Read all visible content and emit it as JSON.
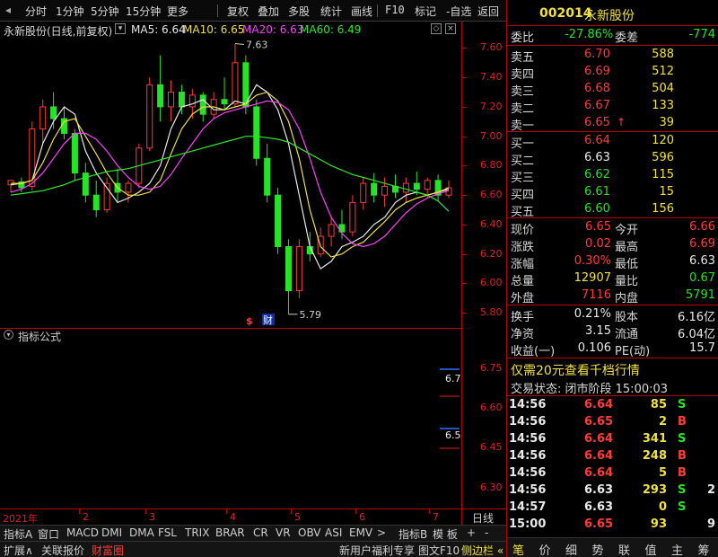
{
  "toolbar": {
    "items": [
      "分时",
      "1分钟",
      "5分钟",
      "15分钟",
      "更多",
      "复权",
      "叠加",
      "多股",
      "统计",
      "画线",
      "F10",
      "标记",
      "-自选",
      "返回"
    ]
  },
  "chart_header": {
    "title": "永新股份(日线,前复权)",
    "ma5_label": "MA5: 6.64",
    "ma10_label": "MA10: 6.65",
    "ma20_label": "MA20: 6.63",
    "ma60_label": "MA60: 6.49"
  },
  "indicator": {
    "title": "指标公式",
    "marker_high": "6.7",
    "marker_low": "6.5"
  },
  "colors": {
    "up": "#ff3b3b",
    "down": "#27e327",
    "ma5": "#e8e8e8",
    "ma10": "#f0e040",
    "ma20": "#ff40ff",
    "ma60": "#2ee82e",
    "axis": "#b40000"
  },
  "chart_data": {
    "type": "candlestick",
    "title": "永新股份(日线,前复权)",
    "y_ticks": [
      "7.60",
      "7.40",
      "7.20",
      "7.00",
      "6.80",
      "6.60",
      "6.40",
      "6.20",
      "6.00",
      "5.80"
    ],
    "ylim": [
      5.74,
      7.67
    ],
    "x_ticks": [
      "2021年",
      "2",
      "3",
      "4",
      "5",
      "6",
      "7"
    ],
    "annotations": {
      "high": "7.63",
      "low": "5.79"
    },
    "markers": [
      "$",
      "财"
    ],
    "indicator_y_ticks": [
      "6.75",
      "6.60",
      "6.45",
      "6.30"
    ],
    "indicator_ylim": [
      6.22,
      6.85
    ],
    "series": [
      {
        "name": "MA5",
        "values": [
          6.67,
          6.68,
          6.7,
          6.95,
          7.1,
          7.2,
          7.15,
          6.9,
          6.75,
          6.65,
          6.55,
          6.58,
          6.62,
          6.68,
          6.8,
          7.05,
          7.2,
          7.22,
          7.25,
          7.18,
          7.18,
          7.24,
          7.22,
          7.35,
          7.3,
          7.18,
          6.95,
          6.6,
          6.25,
          6.1,
          6.15,
          6.25,
          6.28,
          6.32,
          6.4,
          6.45,
          6.55,
          6.6,
          6.62,
          6.6,
          6.62,
          6.64
        ]
      },
      {
        "name": "MA10",
        "values": [
          6.68,
          6.68,
          6.7,
          6.82,
          6.98,
          7.1,
          7.12,
          7.0,
          6.88,
          6.75,
          6.65,
          6.6,
          6.6,
          6.62,
          6.7,
          6.88,
          7.05,
          7.15,
          7.2,
          7.2,
          7.18,
          7.2,
          7.22,
          7.28,
          7.3,
          7.24,
          7.1,
          6.85,
          6.5,
          6.25,
          6.18,
          6.2,
          6.25,
          6.28,
          6.35,
          6.42,
          6.5,
          6.55,
          6.58,
          6.6,
          6.62,
          6.65
        ]
      },
      {
        "name": "MA20",
        "values": [
          6.62,
          6.64,
          6.68,
          6.75,
          6.85,
          6.95,
          7.02,
          7.02,
          6.98,
          6.9,
          6.8,
          6.72,
          6.66,
          6.64,
          6.66,
          6.74,
          6.85,
          6.95,
          7.05,
          7.12,
          7.16,
          7.18,
          7.2,
          7.22,
          7.24,
          7.23,
          7.18,
          7.05,
          6.85,
          6.62,
          6.45,
          6.34,
          6.27,
          6.25,
          6.27,
          6.32,
          6.4,
          6.48,
          6.54,
          6.58,
          6.61,
          6.63
        ]
      },
      {
        "name": "MA60",
        "values": [
          6.6,
          6.61,
          6.62,
          6.63,
          6.65,
          6.67,
          6.7,
          6.72,
          6.74,
          6.76,
          6.77,
          6.78,
          6.8,
          6.82,
          6.84,
          6.86,
          6.88,
          6.9,
          6.92,
          6.94,
          6.96,
          6.98,
          7.0,
          7.0,
          6.99,
          6.98,
          6.96,
          6.92,
          6.88,
          6.84,
          6.8,
          6.77,
          6.74,
          6.72,
          6.7,
          6.68,
          6.66,
          6.64,
          6.62,
          6.6,
          6.56,
          6.49
        ]
      }
    ],
    "candles": [
      [
        6.67,
        6.7,
        6.62,
        6.7
      ],
      [
        6.69,
        6.72,
        6.62,
        6.65
      ],
      [
        6.66,
        7.1,
        6.63,
        7.05
      ],
      [
        7.05,
        7.25,
        6.95,
        7.2
      ],
      [
        7.2,
        7.3,
        7.05,
        7.12
      ],
      [
        7.12,
        7.2,
        6.98,
        7.02
      ],
      [
        7.02,
        7.05,
        6.7,
        6.75
      ],
      [
        6.75,
        6.82,
        6.55,
        6.6
      ],
      [
        6.6,
        6.7,
        6.45,
        6.5
      ],
      [
        6.5,
        6.72,
        6.48,
        6.68
      ],
      [
        6.68,
        6.78,
        6.55,
        6.62
      ],
      [
        6.62,
        6.7,
        6.55,
        6.68
      ],
      [
        6.68,
        6.95,
        6.65,
        6.92
      ],
      [
        6.92,
        7.4,
        6.9,
        7.35
      ],
      [
        7.35,
        7.55,
        7.1,
        7.2
      ],
      [
        7.2,
        7.38,
        7.1,
        7.3
      ],
      [
        7.3,
        7.35,
        7.15,
        7.2
      ],
      [
        7.2,
        7.32,
        7.12,
        7.28
      ],
      [
        7.28,
        7.3,
        7.1,
        7.15
      ],
      [
        7.15,
        7.3,
        7.12,
        7.25
      ],
      [
        7.25,
        7.4,
        7.18,
        7.22
      ],
      [
        7.22,
        7.63,
        7.2,
        7.5
      ],
      [
        7.5,
        7.55,
        7.15,
        7.2
      ],
      [
        7.2,
        7.25,
        6.8,
        6.85
      ],
      [
        6.85,
        6.95,
        6.55,
        6.6
      ],
      [
        6.6,
        6.65,
        6.2,
        6.25
      ],
      [
        6.25,
        6.3,
        5.79,
        5.95
      ],
      [
        5.95,
        6.3,
        5.9,
        6.25
      ],
      [
        6.25,
        6.35,
        6.15,
        6.2
      ],
      [
        6.2,
        6.38,
        6.18,
        6.32
      ],
      [
        6.32,
        6.45,
        6.25,
        6.4
      ],
      [
        6.4,
        6.5,
        6.3,
        6.35
      ],
      [
        6.35,
        6.6,
        6.32,
        6.55
      ],
      [
        6.55,
        6.72,
        6.5,
        6.68
      ],
      [
        6.68,
        6.75,
        6.55,
        6.6
      ],
      [
        6.6,
        6.72,
        6.52,
        6.66
      ],
      [
        6.66,
        6.74,
        6.58,
        6.62
      ],
      [
        6.62,
        6.72,
        6.55,
        6.68
      ],
      [
        6.68,
        6.76,
        6.6,
        6.64
      ],
      [
        6.64,
        6.72,
        6.58,
        6.7
      ],
      [
        6.7,
        6.74,
        6.56,
        6.6
      ],
      [
        6.6,
        6.7,
        6.58,
        6.65
      ]
    ]
  },
  "quote": {
    "code": "002014",
    "name": "永新股份",
    "weibi_label": "委比",
    "weibi": "-27.86%",
    "weicha_label": "委差",
    "weicha": "-774",
    "asks": [
      {
        "label": "卖五",
        "price": "6.70",
        "vol": "588"
      },
      {
        "label": "卖四",
        "price": "6.69",
        "vol": "512"
      },
      {
        "label": "卖三",
        "price": "6.68",
        "vol": "504"
      },
      {
        "label": "卖二",
        "price": "6.67",
        "vol": "133"
      },
      {
        "label": "卖一",
        "price": "6.65",
        "vol": "39",
        "arrow": "↑"
      }
    ],
    "bids": [
      {
        "label": "买一",
        "price": "6.64",
        "vol": "120"
      },
      {
        "label": "买二",
        "price": "6.63",
        "vol": "596"
      },
      {
        "label": "买三",
        "price": "6.62",
        "vol": "115"
      },
      {
        "label": "买四",
        "price": "6.61",
        "vol": "15"
      },
      {
        "label": "买五",
        "price": "6.60",
        "vol": "156"
      }
    ],
    "stats": [
      {
        "l1": "现价",
        "v1": "6.65",
        "l2": "今开",
        "v2": "6.66"
      },
      {
        "l1": "涨跌",
        "v1": "0.02",
        "l2": "最高",
        "v2": "6.69"
      },
      {
        "l1": "涨幅",
        "v1": "0.30%",
        "l2": "最低",
        "v2": "6.63"
      },
      {
        "l1": "总量",
        "v1": "12907",
        "l2": "量比",
        "v2": "0.67"
      },
      {
        "l1": "外盘",
        "v1": "7116",
        "l2": "内盘",
        "v2": "5791"
      }
    ],
    "fin": [
      {
        "l1": "换手",
        "v1": "0.21%",
        "l2": "股本",
        "v2": "6.16亿"
      },
      {
        "l1": "净资",
        "v1": "3.15",
        "l2": "流通",
        "v2": "6.04亿"
      },
      {
        "l1": "收益(一)",
        "v1": "0.106",
        "l2": "PE(动)",
        "v2": "15.7"
      }
    ],
    "promo": "仅需20元查看千档行情",
    "status": "交易状态: 闭市阶段 15:00:03",
    "ticks": [
      {
        "t": "14:56",
        "p": "6.64",
        "v": "85",
        "s": "S"
      },
      {
        "t": "14:56",
        "p": "6.65",
        "v": "2",
        "s": "B"
      },
      {
        "t": "14:56",
        "p": "6.64",
        "v": "341",
        "s": "S"
      },
      {
        "t": "14:56",
        "p": "6.64",
        "v": "248",
        "s": "B"
      },
      {
        "t": "14:56",
        "p": "6.64",
        "v": "5",
        "s": "B"
      },
      {
        "t": "14:56",
        "p": "6.63",
        "v": "293",
        "s": "S",
        "n": "2"
      },
      {
        "t": "14:57",
        "p": "6.63",
        "v": "0",
        "s": "S"
      },
      {
        "t": "15:00",
        "p": "6.65",
        "v": "93",
        "s": "",
        "n": "9"
      }
    ]
  },
  "bottom": {
    "row1_left": [
      "指标A",
      "窗口",
      "MACD",
      "DMI",
      "DMA",
      "FSL",
      "TRIX",
      "BRAR",
      "CR",
      "VR",
      "OBV",
      "ASI",
      "EMV",
      ">"
    ],
    "row1_right": [
      "指标B",
      "模 板",
      "+",
      "-"
    ],
    "row1_end": "日线",
    "row2_left": [
      "扩展∧",
      "关联报价",
      "财富圈"
    ],
    "row2_right": [
      "新用户福利专享",
      "图文F10",
      "侧边栏 «"
    ],
    "right_tabs": [
      "笔",
      "价",
      "细",
      "势",
      "联",
      "值",
      "主",
      "筹"
    ]
  }
}
